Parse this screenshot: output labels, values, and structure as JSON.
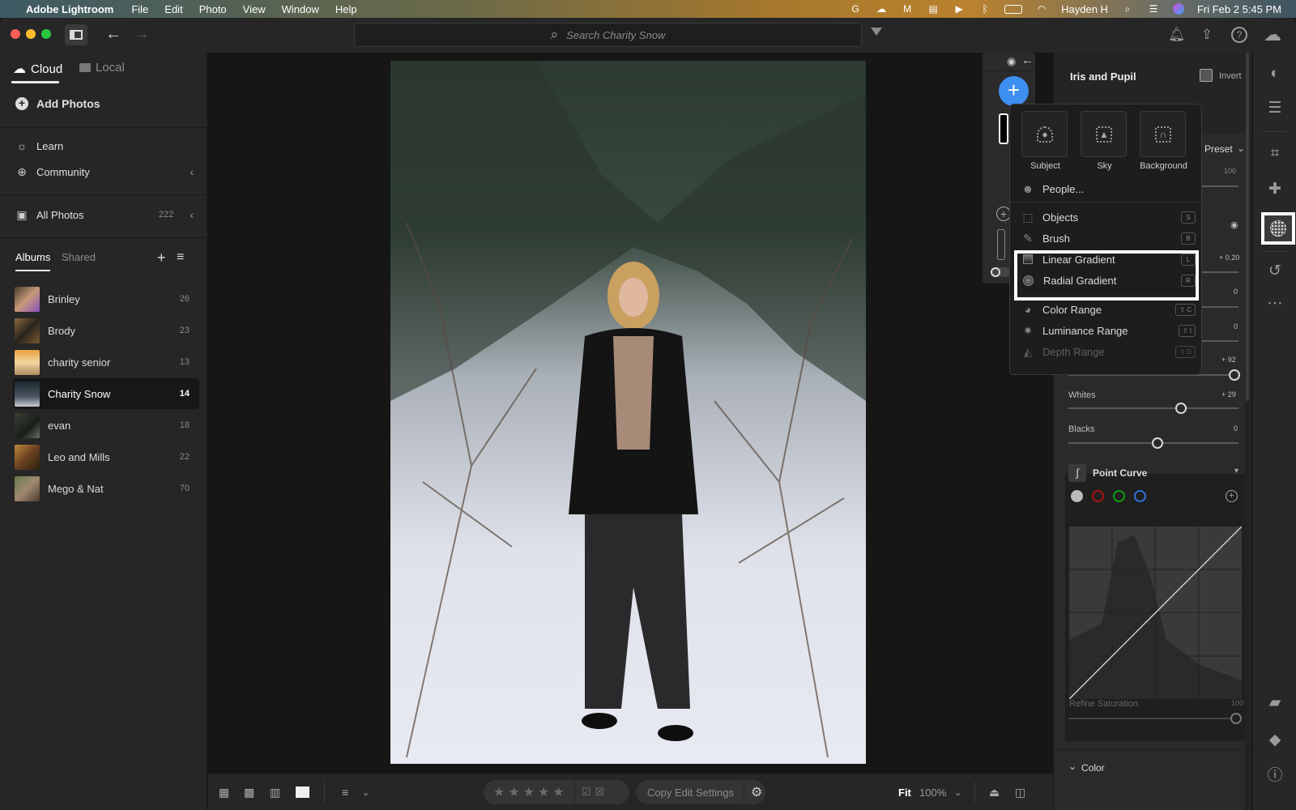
{
  "menubar": {
    "app_name": "Adobe Lightroom",
    "menus": [
      "File",
      "Edit",
      "Photo",
      "View",
      "Window",
      "Help"
    ],
    "user": "Hayden H",
    "datetime": "Fri Feb 2  5:45 PM"
  },
  "toolbar": {
    "search_placeholder": "Search Charity Snow"
  },
  "leftbar": {
    "tabs": [
      {
        "label": "Cloud",
        "active": true
      },
      {
        "label": "Local",
        "active": false
      }
    ],
    "add_photos": "Add Photos",
    "learn": "Learn",
    "community": "Community",
    "all_photos": {
      "label": "All Photos",
      "count": "222"
    },
    "album_tabs": [
      {
        "label": "Albums",
        "active": true
      },
      {
        "label": "Shared",
        "active": false
      }
    ],
    "albums": [
      {
        "name": "Brinley",
        "count": "26",
        "selected": false
      },
      {
        "name": "Brody",
        "count": "23",
        "selected": false
      },
      {
        "name": "charity senior",
        "count": "13",
        "selected": false
      },
      {
        "name": "Charity Snow",
        "count": "14",
        "selected": true
      },
      {
        "name": "evan",
        "count": "18",
        "selected": false
      },
      {
        "name": "Leo and Mills",
        "count": "22",
        "selected": false
      },
      {
        "name": "Mego & Nat",
        "count": "70",
        "selected": false
      }
    ]
  },
  "mask_menu": {
    "tiles": [
      {
        "label": "Subject"
      },
      {
        "label": "Sky"
      },
      {
        "label": "Background"
      }
    ],
    "items": [
      {
        "label": "People...",
        "shortcut": "",
        "disabled": false
      },
      {
        "label": "Objects",
        "shortcut": "S",
        "disabled": false
      },
      {
        "label": "Brush",
        "shortcut": "B",
        "disabled": false
      },
      {
        "label": "Linear Gradient",
        "shortcut": "L",
        "disabled": false,
        "highlighted": true
      },
      {
        "label": "Radial Gradient",
        "shortcut": "R",
        "disabled": false,
        "highlighted": true
      },
      {
        "label": "Color Range",
        "shortcut": "⇧ C",
        "disabled": false
      },
      {
        "label": "Luminance Range",
        "shortcut": "⇧ I",
        "disabled": false
      },
      {
        "label": "Depth Range",
        "shortcut": "⇧ D",
        "disabled": true
      }
    ]
  },
  "rightpanel": {
    "mask_name": "Iris and Pupil",
    "invert_label": "Invert",
    "preset_label": "Preset",
    "amount_value": "100",
    "exposure_value": "+ 0.20",
    "contrast_value": "0",
    "highlights_value": "0",
    "shadows_value": "+ 92",
    "whites": {
      "label": "Whites",
      "value": "+ 29"
    },
    "blacks": {
      "label": "Blacks",
      "value": "0"
    },
    "point_curve_label": "Point Curve",
    "refine_saturation": {
      "label": "Refine Saturation",
      "value": "100"
    },
    "color_section": "Color"
  },
  "bottombar": {
    "copy_edit_settings": "Copy Edit Settings",
    "fit_label": "Fit",
    "zoom_value": "100%"
  }
}
